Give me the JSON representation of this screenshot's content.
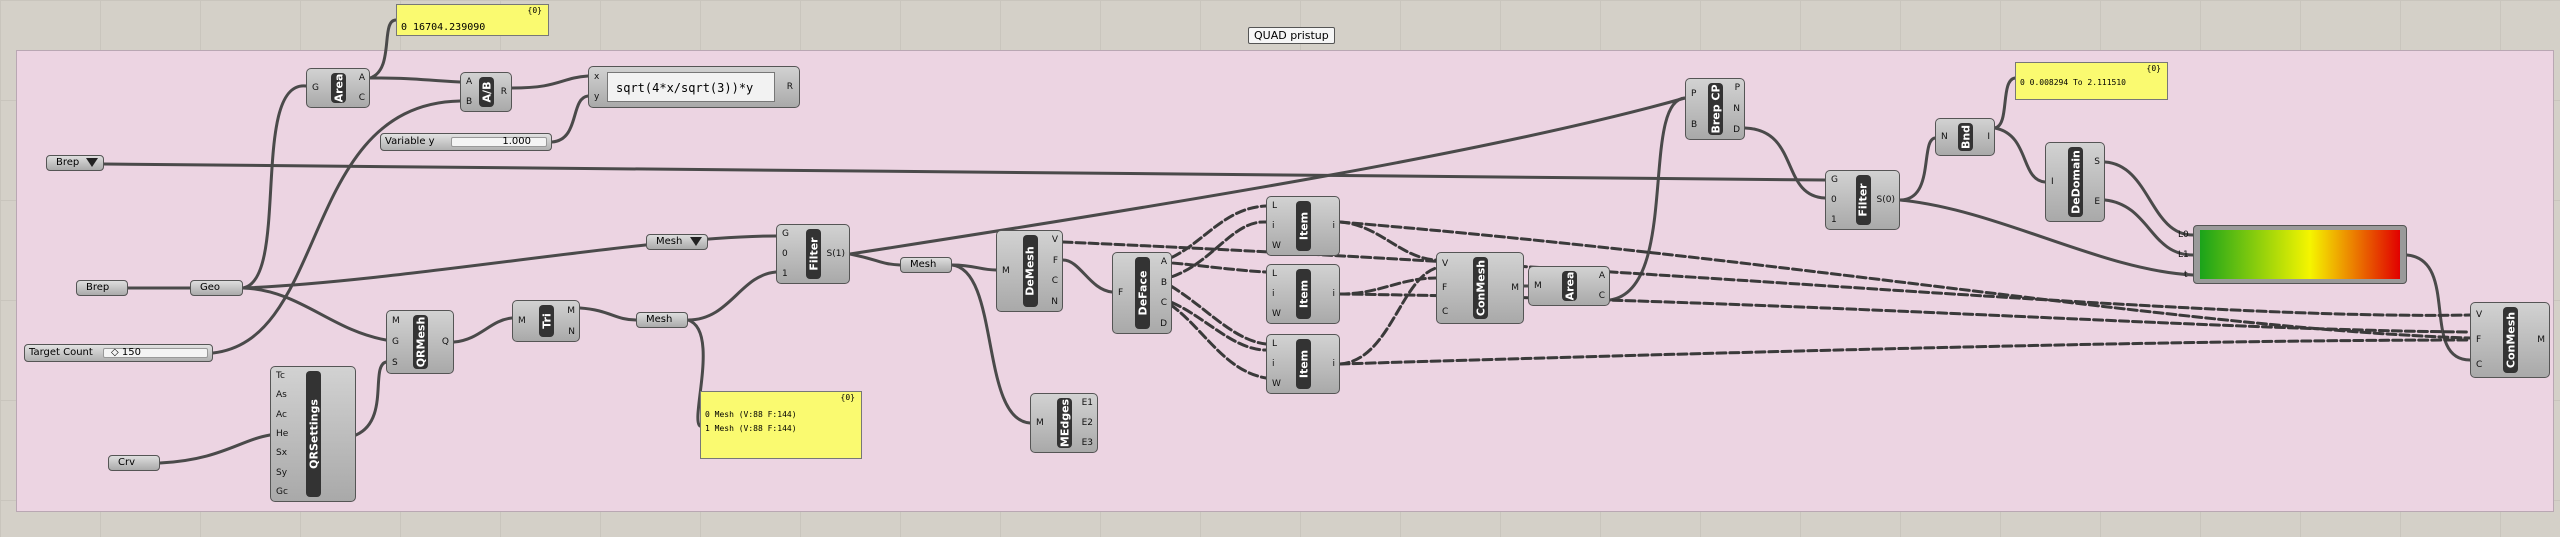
{
  "group": {
    "label": "QUAD pristup"
  },
  "panels": {
    "area_out": {
      "header": "{0}",
      "lines": [
        "0 16704.239090"
      ]
    },
    "domain_out": {
      "header": "{0}",
      "lines": [
        "0 0.008294 To 2.111510"
      ]
    },
    "mesh_out": {
      "header": "{0}",
      "lines": [
        "0 Mesh (V:88  F:144)",
        "1 Mesh (V:88  F:144)"
      ]
    }
  },
  "params": {
    "brep_top": "Brep",
    "brep_left": "Brep",
    "geo": "Geo",
    "crv": "Crv",
    "mesh_a": "Mesh",
    "mesh_b": "Mesh",
    "mesh_c": "Mesh"
  },
  "sliders": {
    "variable_y": {
      "label": "Variable y",
      "value": "1.000"
    },
    "target_count": {
      "label": "Target Count",
      "value": "◇ 150"
    }
  },
  "expression": {
    "text": "sqrt(4*x/sqrt(3))*y",
    "in": [
      "x",
      "y"
    ],
    "out": "R"
  },
  "components": {
    "area1": {
      "name": "Area",
      "inputs": [
        "G"
      ],
      "outputs": [
        "A",
        "C"
      ]
    },
    "divide": {
      "name": "A/B",
      "inputs": [
        "A",
        "B"
      ],
      "outputs": [
        "R"
      ]
    },
    "filter1": {
      "name": "Filter",
      "inputs": [
        "G",
        "0",
        "1"
      ],
      "outputs": [
        "S(1)"
      ]
    },
    "qrmesh": {
      "name": "QRMesh",
      "inputs": [
        "M",
        "G",
        "S"
      ],
      "outputs": [
        "Q"
      ]
    },
    "qrsettings": {
      "name": "QRSettings",
      "inputs": [
        "Tc",
        "As",
        "Ac",
        "He",
        "Sx",
        "Sy",
        "Gc"
      ]
    },
    "tri": {
      "name": "Tri",
      "inputs": [
        "M"
      ],
      "outputs": [
        "M",
        "N"
      ]
    },
    "demesh": {
      "name": "DeMesh",
      "inputs": [
        "M"
      ],
      "outputs": [
        "V",
        "F",
        "C",
        "N"
      ]
    },
    "medges": {
      "name": "MEdges",
      "inputs": [
        "M"
      ],
      "outputs": [
        "E1",
        "E2",
        "E3"
      ]
    },
    "deface": {
      "name": "DeFace",
      "inputs": [
        "F"
      ],
      "outputs": [
        "A",
        "B",
        "C",
        "D"
      ]
    },
    "item1": {
      "name": "Item",
      "inputs": [
        "L",
        "i",
        "W"
      ],
      "outputs": [
        "i"
      ]
    },
    "item2": {
      "name": "Item",
      "inputs": [
        "L",
        "i",
        "W"
      ],
      "outputs": [
        "i"
      ]
    },
    "item3": {
      "name": "Item",
      "inputs": [
        "L",
        "i",
        "W"
      ],
      "outputs": [
        "i"
      ]
    },
    "conmesh1": {
      "name": "ConMesh",
      "inputs": [
        "V",
        "F",
        "C"
      ],
      "outputs": [
        "M"
      ]
    },
    "area2": {
      "name": "Area",
      "inputs": [
        "M"
      ],
      "outputs": [
        "A",
        "C"
      ]
    },
    "brepcp": {
      "name": "Brep CP",
      "inputs": [
        "P",
        "B"
      ],
      "outputs": [
        "P",
        "N",
        "D"
      ]
    },
    "filter2": {
      "name": "Filter",
      "inputs": [
        "G",
        "0",
        "1"
      ],
      "outputs": [
        "S(0)"
      ]
    },
    "bnd": {
      "name": "Bnd",
      "inputs": [
        "N"
      ],
      "outputs": [
        "I"
      ]
    },
    "dedomain": {
      "name": "DeDomain",
      "inputs": [
        "I"
      ],
      "outputs": [
        "S",
        "E"
      ]
    },
    "gradient": {
      "inputs": [
        "L0",
        "L1",
        "t"
      ]
    },
    "conmesh2": {
      "name": "ConMesh",
      "inputs": [
        "V",
        "F",
        "C"
      ],
      "outputs": [
        "M"
      ]
    }
  },
  "colors": {
    "canvas": "#d4d0c8",
    "group_fill": "#ecd4e2",
    "panel": "#fafa70",
    "gradient": [
      "#1aa31a",
      "#f5f500",
      "#e10000"
    ]
  }
}
